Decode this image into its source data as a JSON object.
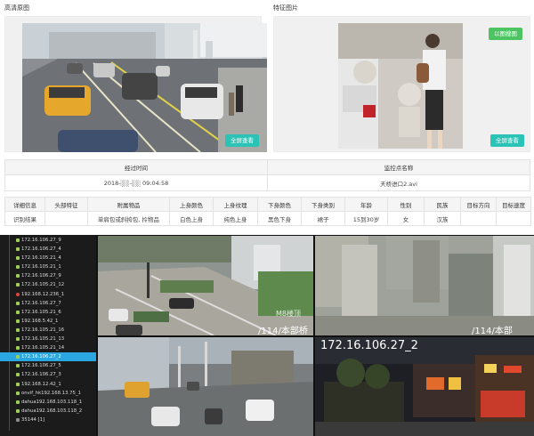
{
  "sections": {
    "hd_image_title": "高清原图",
    "feature_image_title": "特征图片"
  },
  "buttons": {
    "fullscreen_left": "全屏查看",
    "fullscreen_right": "全屏查看",
    "search_by_image": "以图搜图"
  },
  "pass_table": {
    "headers": [
      "经过时间",
      "监控点名称"
    ],
    "values": [
      "2018-░░-░░ 09:04:58",
      "天桥进口2.avi"
    ]
  },
  "detail_table": {
    "headers": [
      "详细信息",
      "头部特征",
      "附属物品",
      "上身颜色",
      "上身纹理",
      "下身颜色",
      "下身类别",
      "年龄",
      "性别",
      "民族",
      "目标方向",
      "目标速度"
    ],
    "values": [
      "识别结果",
      "",
      "单肩包或斜挎包, 拎物品",
      "白色上身",
      "纯色上身",
      "黑色下身",
      "裙子",
      "15到30岁",
      "女",
      "汉族",
      "",
      ""
    ]
  },
  "device_tree": {
    "items": [
      {
        "label": "172.16.106.27_9",
        "icon": "camera-icon"
      },
      {
        "label": "172.16.106.27_4",
        "icon": "camera-icon"
      },
      {
        "label": "172.16.105.21_4",
        "icon": "camera-icon"
      },
      {
        "label": "172.16.105.21_1",
        "icon": "camera-icon"
      },
      {
        "label": "172.16.106.27_9",
        "icon": "camera-icon"
      },
      {
        "label": "172.16.105.21_12",
        "icon": "camera-icon"
      },
      {
        "label": "192.168.12.236_1",
        "icon": "alert-icon"
      },
      {
        "label": "172.16.106.27_7",
        "icon": "camera-icon"
      },
      {
        "label": "172.16.105.21_6",
        "icon": "camera-icon"
      },
      {
        "label": "192.168.5.42_1",
        "icon": "camera-icon"
      },
      {
        "label": "172.16.105.21_16",
        "icon": "camera-icon"
      },
      {
        "label": "172.16.105.21_13",
        "icon": "camera-icon"
      },
      {
        "label": "172.16.105.21_14",
        "icon": "camera-icon"
      },
      {
        "label": "172.16.106.27_2",
        "icon": "camera-icon",
        "selected": true
      },
      {
        "label": "172.16.106.27_5",
        "icon": "camera-icon"
      },
      {
        "label": "172.16.106.27_3",
        "icon": "camera-icon"
      },
      {
        "label": "192.168.12.42_1",
        "icon": "camera-icon"
      },
      {
        "label": "onvif_hk192.168.13.75_1",
        "icon": "camera-icon"
      },
      {
        "label": "dahua192.168.103.118_1",
        "icon": "camera-icon"
      },
      {
        "label": "dahua192.168.103.118_2",
        "icon": "camera-icon"
      },
      {
        "label": "35144 [1]",
        "icon": "folder-icon"
      }
    ]
  },
  "video_grid": {
    "cams": [
      {
        "overlay": "/114/本部桥"
      },
      {
        "overlay": "/114/本部"
      },
      {
        "overlay": ""
      },
      {
        "overlay": "172.16.106.27_2"
      }
    ],
    "watermark": "M8楼顶"
  }
}
